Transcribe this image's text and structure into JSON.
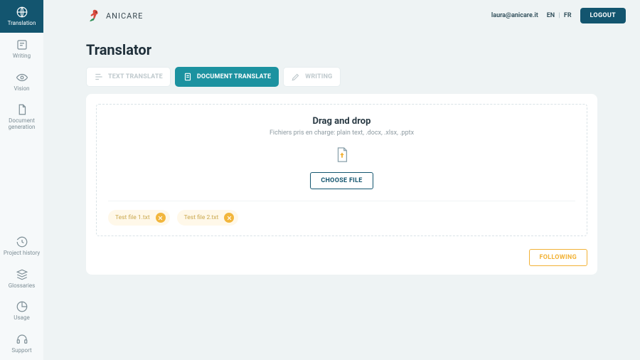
{
  "brand": {
    "name": "ANICARE"
  },
  "header": {
    "email": "laura@anicare.it",
    "lang": {
      "en": "EN",
      "fr": "FR",
      "sep": "|"
    },
    "logout": "LOGOUT"
  },
  "sidebar": {
    "top": [
      {
        "label": "Translation"
      },
      {
        "label": "Writing"
      },
      {
        "label": "Vision"
      },
      {
        "label": "Document generation"
      }
    ],
    "bottom": [
      {
        "label": "Project history"
      },
      {
        "label": "Glossaries"
      },
      {
        "label": "Usage"
      },
      {
        "label": "Support"
      }
    ]
  },
  "page": {
    "title": "Translator"
  },
  "tabs": [
    {
      "label": "TEXT TRANSLATE"
    },
    {
      "label": "DOCUMENT TRANSLATE"
    },
    {
      "label": "WRITING"
    }
  ],
  "dropzone": {
    "title": "Drag and drop",
    "subtitle": "Fichiers pris en charge: plain text, .docx, .xlsx, .pptx",
    "choose": "CHOOSE FILE"
  },
  "files": [
    {
      "name": "Test file 1.txt"
    },
    {
      "name": "Test file 2.txt"
    }
  ],
  "footer": {
    "following": "FOLLOWING"
  }
}
